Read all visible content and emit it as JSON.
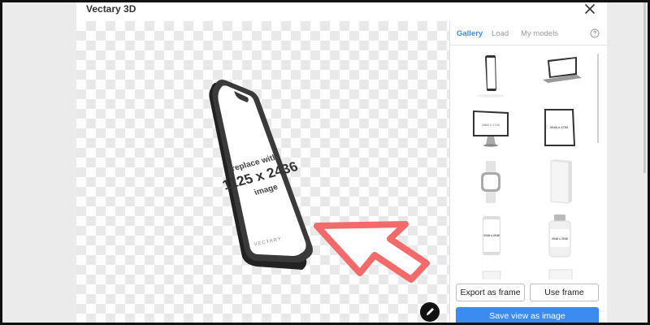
{
  "modal": {
    "title": "Vectary 3D"
  },
  "canvas": {
    "phone_screen_text": [
      "replace with",
      "1125 x 2436",
      "image"
    ],
    "phone_brand": "VECTARY"
  },
  "panel": {
    "tabs": [
      {
        "label": "Gallery",
        "active": true
      },
      {
        "label": "Load",
        "active": false
      },
      {
        "label": "My models",
        "active": false
      }
    ],
    "gallery_items": [
      {
        "icon": "phone-mockup-icon"
      },
      {
        "icon": "laptop-mockup-icon"
      },
      {
        "icon": "imac-mockup-icon",
        "caption": "2880 x 1740"
      },
      {
        "icon": "tablet-mockup-icon",
        "caption": "2048 x 2732"
      },
      {
        "icon": "smartwatch-mockup-icon"
      },
      {
        "icon": "box-mockup-icon"
      },
      {
        "icon": "can-mockup-icon",
        "caption": "2048 x 2048"
      },
      {
        "icon": "bottle-mockup-icon",
        "caption": "2048 x 2048"
      },
      {
        "icon": "cup-mockup-icon"
      },
      {
        "icon": "pouch-mockup-icon"
      }
    ],
    "buttons": {
      "export": "Export as frame",
      "use": "Use frame",
      "save": "Save view as image"
    }
  },
  "colors": {
    "accent": "#3c8cf0",
    "arrow": "#f26a6a",
    "phone_body": "#3a3a3a"
  }
}
